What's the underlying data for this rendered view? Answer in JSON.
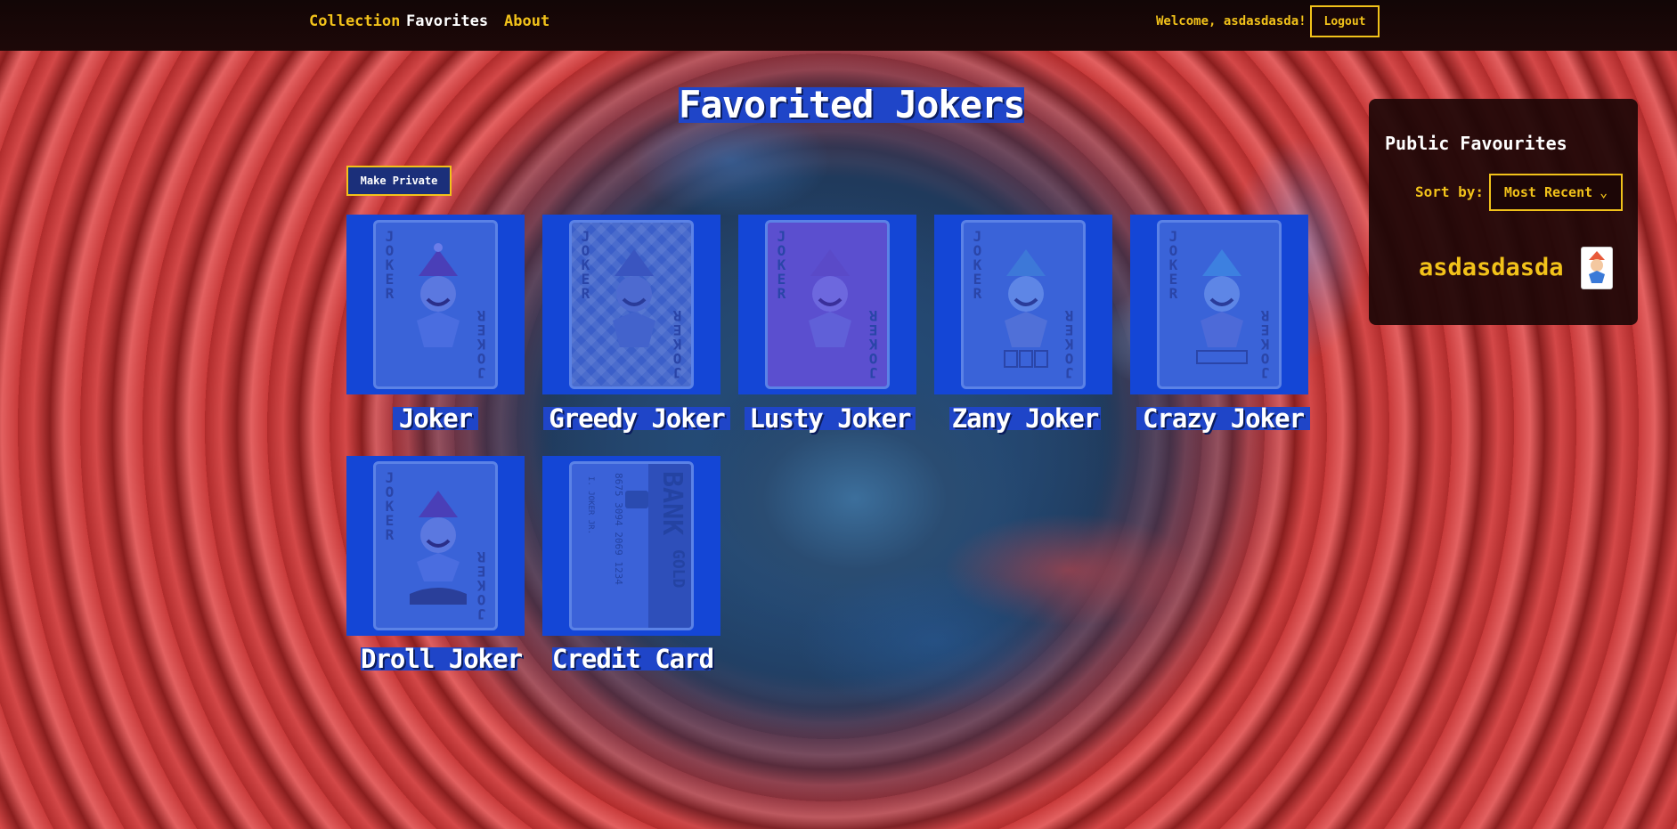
{
  "nav": {
    "collection": "Collection",
    "favorites": "Favorites",
    "about": "About",
    "welcome": "Welcome, asdasdasda!",
    "logout": "Logout"
  },
  "main": {
    "title": "Favorited Jokers",
    "make_private": "Make Private",
    "corner_text": "JOKER",
    "cards": [
      {
        "name": "Joker",
        "icon": "joker-card-icon"
      },
      {
        "name": "Greedy Joker",
        "icon": "greedy-joker-card-icon"
      },
      {
        "name": "Lusty Joker",
        "icon": "lusty-joker-card-icon"
      },
      {
        "name": "Zany Joker",
        "icon": "zany-joker-card-icon"
      },
      {
        "name": "Crazy Joker",
        "icon": "crazy-joker-card-icon"
      },
      {
        "name": "Droll Joker",
        "icon": "droll-joker-card-icon"
      },
      {
        "name": "Credit Card",
        "icon": "credit-card-icon"
      }
    ],
    "credit_card": {
      "bank": "BANK",
      "gold": "GOLD",
      "number": "8675 3094 2069 1234",
      "holder": "I. JOKER JR."
    }
  },
  "sidebar": {
    "title": "Public Favourites",
    "sort_label": "Sort by:",
    "sort_value": "Most Recent",
    "user": "asdasdasda"
  },
  "colors": {
    "accent": "#f2c21a",
    "card_blue": "#1446d6",
    "label_blue": "#1f45c8"
  }
}
